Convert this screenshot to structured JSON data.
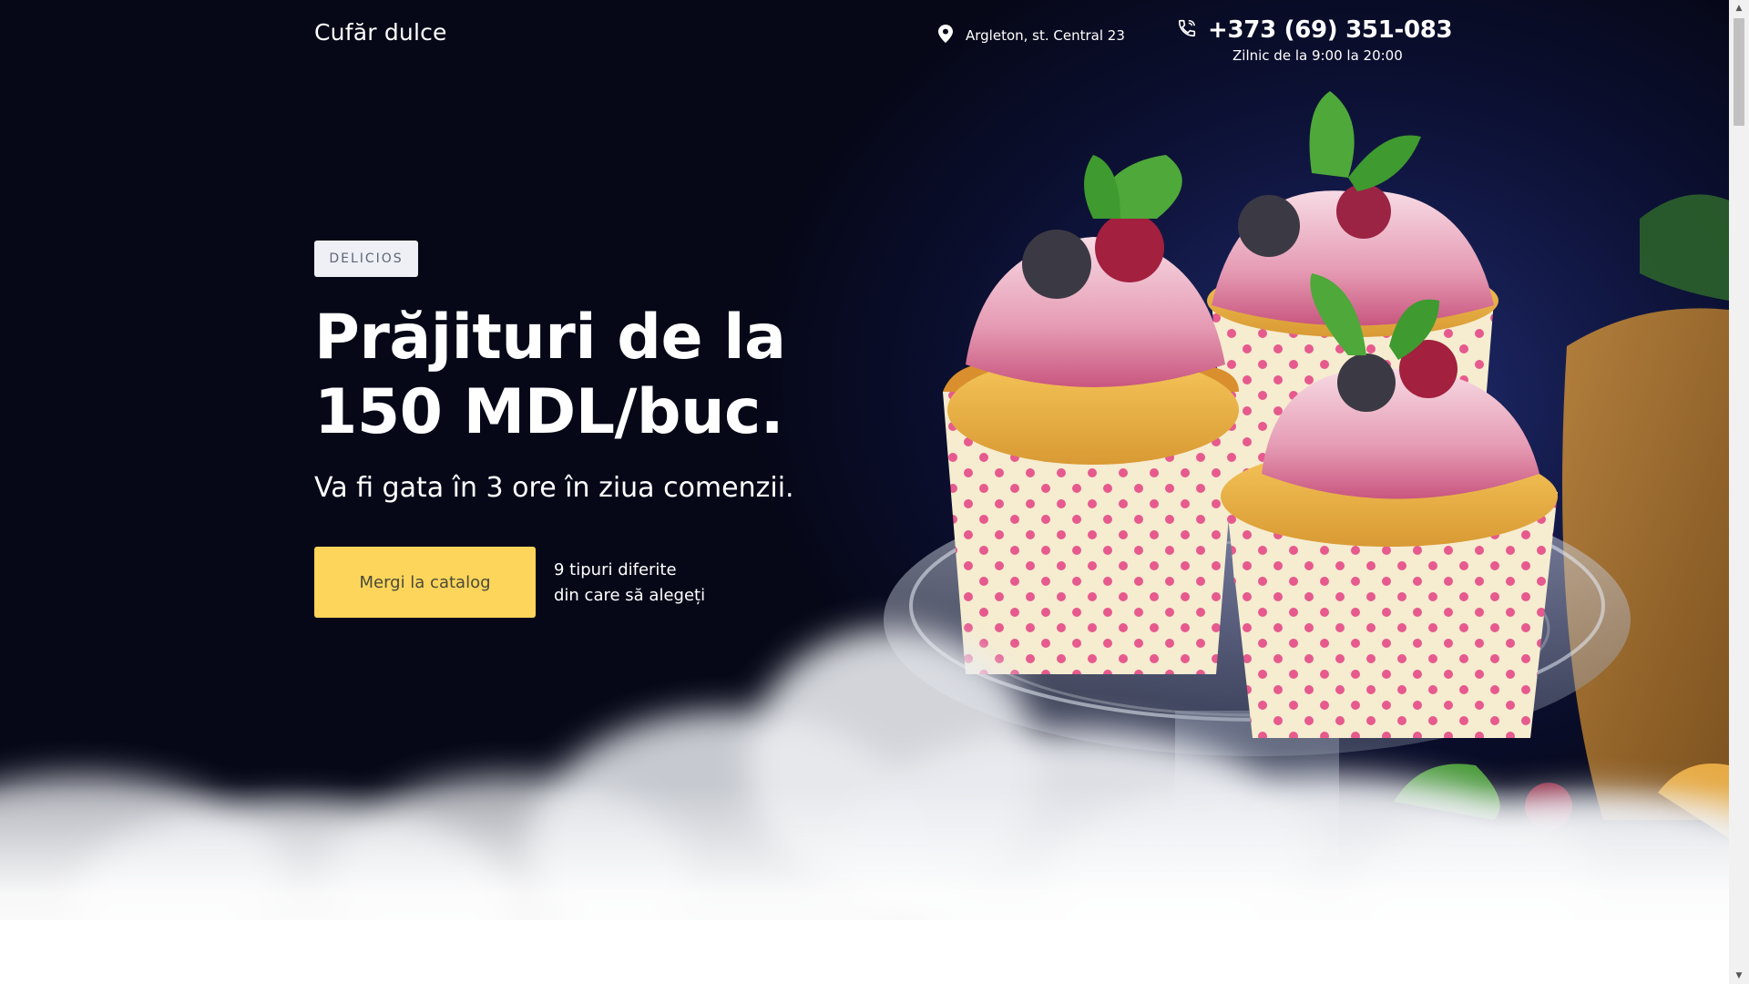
{
  "header": {
    "logo": "Cufăr dulce",
    "address": "Argleton, st. Central 23",
    "phone": "+373 (69) 351-083",
    "schedule": "Zilnic de la 9:00 la 20:00"
  },
  "hero": {
    "badge": "DELICIOS",
    "title": "Prăjituri de la 150 MDL/buc.",
    "subtitle": "Va fi gata în 3 ore în ziua comenzii.",
    "cta_label": "Mergi la catalog",
    "note_line1": "9 tipuri diferite",
    "note_line2": "din care să alegeți"
  },
  "icons": {
    "address": "map-pin-icon",
    "phone": "phone-icon"
  },
  "colors": {
    "background": "#07091a",
    "accent": "#fdd55b",
    "badge_bg": "#eef0f5"
  }
}
